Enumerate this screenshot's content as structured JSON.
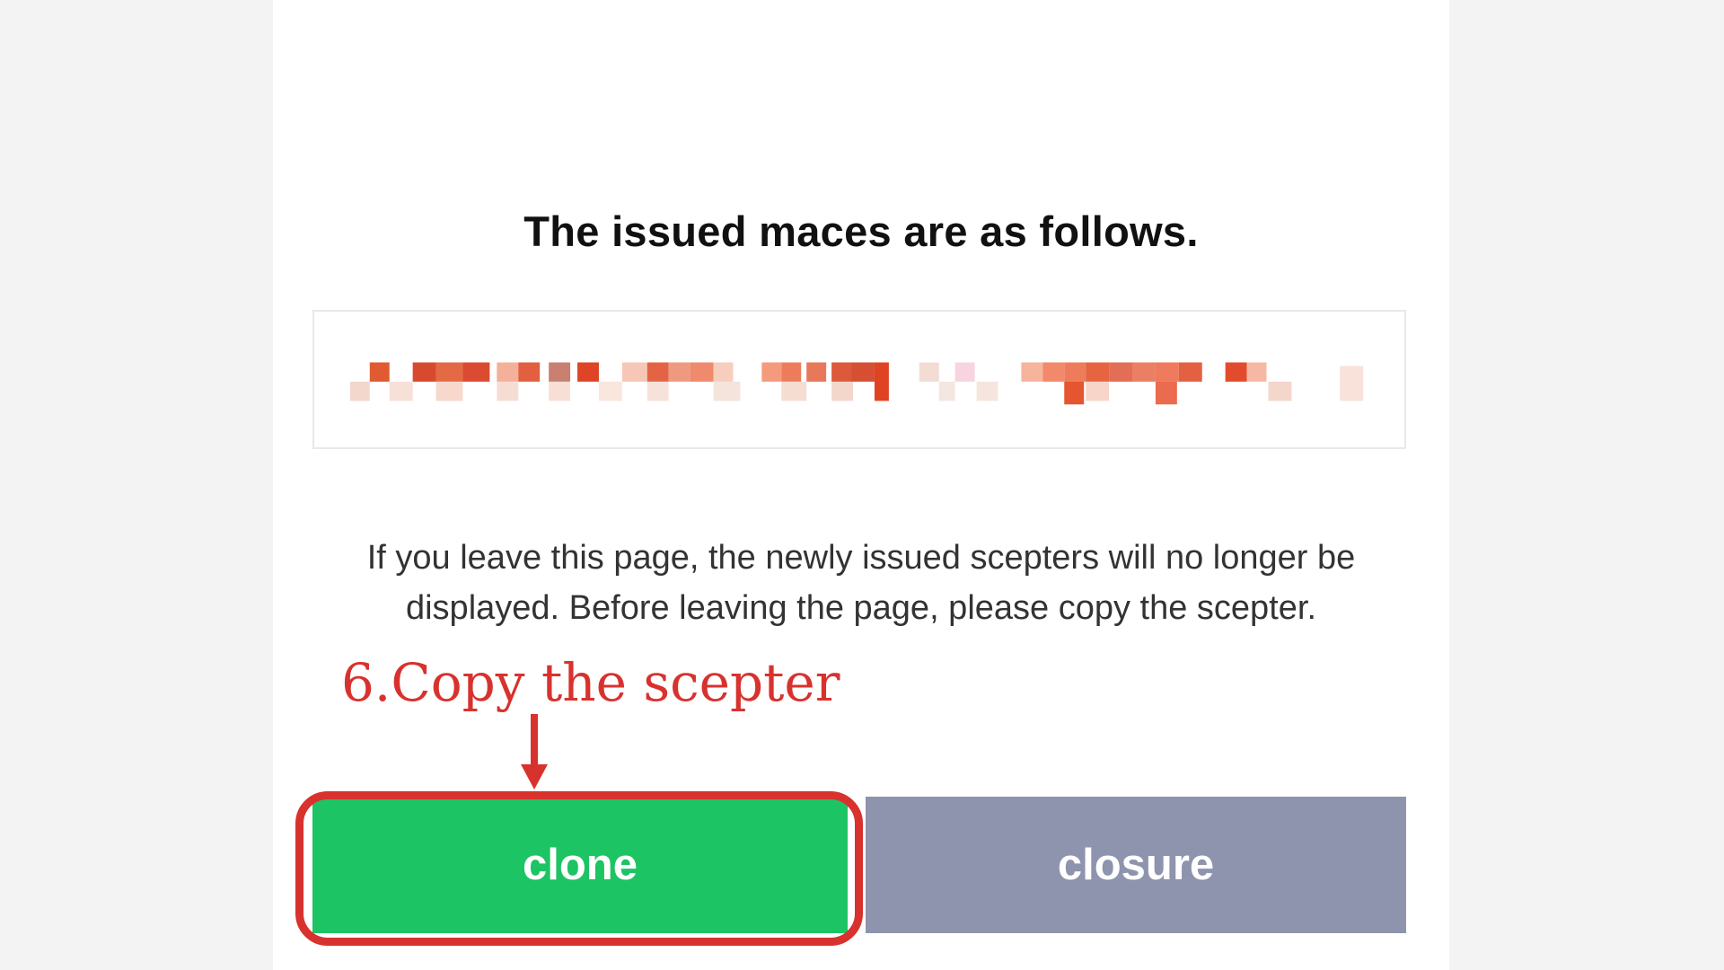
{
  "dialog": {
    "heading": "The issued maces are as follows.",
    "key_value_state": "pixelated / redacted",
    "note_line1": "If you leave this page, the newly issued scepters will no longer be",
    "note_line2": "displayed. Before leaving the page, please copy the scepter.",
    "buttons": {
      "clone_label": "clone",
      "closure_label": "closure"
    }
  },
  "annotation": {
    "label": "6.Copy the scepter",
    "color": "#d8322e",
    "target": "clone-button"
  },
  "colors": {
    "clone_button": "#1dc463",
    "closure_button": "#8e93ae",
    "annotation": "#d8322e"
  }
}
